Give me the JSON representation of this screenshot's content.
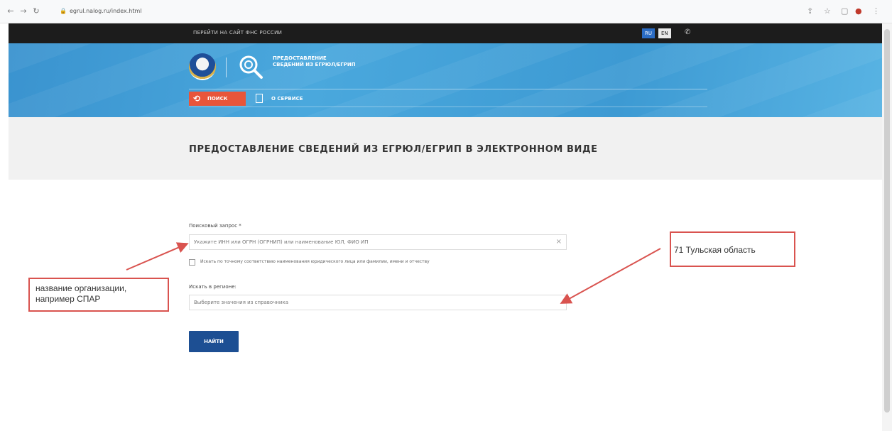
{
  "browser": {
    "url": "egrul.nalog.ru/index.html",
    "icons": [
      "back-icon",
      "forward-icon",
      "reload-icon",
      "lock-icon",
      "share-icon",
      "star-icon",
      "window-icon",
      "profile-icon",
      "menu-icon"
    ]
  },
  "topbar": {
    "link": "ПЕРЕЙТИ НА САЙТ ФНС РОССИИ",
    "lang_ru": "RU",
    "lang_en": "EN",
    "phone": "✆"
  },
  "header": {
    "title": "ПРЕДОСТАВЛЕНИЕ СВЕДЕНИЙ ИЗ ЕГРЮЛ/ЕГРИП",
    "tab_search": "ПОИСК",
    "tab_info": "О СЕРВИСЕ"
  },
  "page": {
    "title": "ПРЕДОСТАВЛЕНИЕ СВЕДЕНИЙ ИЗ ЕГРЮЛ/ЕГРИП В ЭЛЕКТРОННОМ ВИДЕ"
  },
  "form": {
    "query_label": "Поисковый запрос *",
    "query_placeholder": "Укажите ИНН или ОГРН (ОГРНИП) или наименование ЮЛ, ФИО ИП",
    "clear_icon": "×",
    "exact_match_label": "Искать по точному соответствию наименования юридического лица или фамилии, имени и отчеству",
    "region_label": "Искать в регионе:",
    "region_placeholder": "Выберите значения из справочника",
    "find_button": "НАЙТИ"
  },
  "annotations": {
    "left_note": "название организации, например СПАР",
    "right_note": "71 Тульская область",
    "color": "#d9534f"
  },
  "colors": {
    "header_blue": "#3d9ad3",
    "accent_orange": "#e8553a",
    "button_blue": "#1d4f93"
  }
}
